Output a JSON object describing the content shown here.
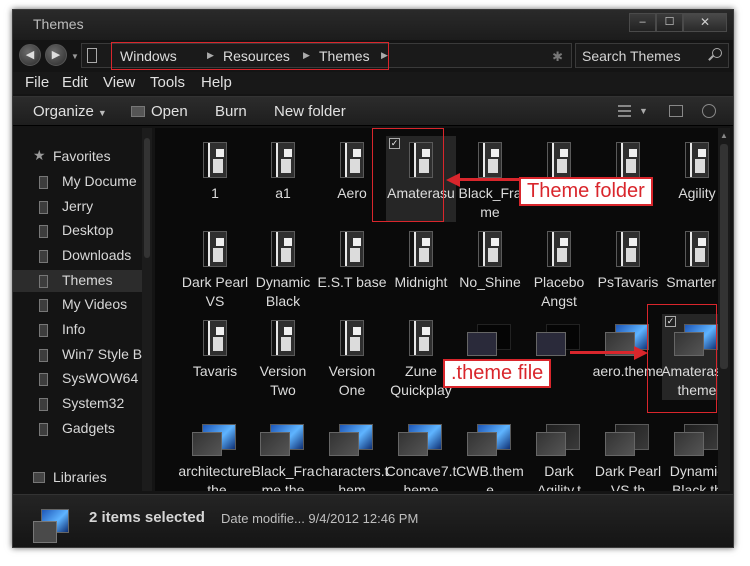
{
  "window": {
    "title": "Themes",
    "min_label": "–",
    "max_label": "☐",
    "close_label": "✕"
  },
  "address": {
    "crumbs": [
      "Windows",
      "Resources",
      "Themes"
    ],
    "search_placeholder": "Search Themes",
    "back_glyph": "◀",
    "forward_glyph": "▶"
  },
  "menu": [
    "File",
    "Edit",
    "View",
    "Tools",
    "Help"
  ],
  "toolbar": {
    "organize": "Organize",
    "open": "Open",
    "burn": "Burn",
    "new_folder": "New folder"
  },
  "sidebar": {
    "favorites": "Favorites",
    "items": [
      "My Docume",
      "Jerry",
      "Desktop",
      "Downloads",
      "Themes",
      "My Videos",
      "Info",
      "Win7 Style B",
      "SysWOW64",
      "System32",
      "Gadgets"
    ],
    "selected": "Themes",
    "libraries": "Libraries"
  },
  "files": [
    {
      "label": "1",
      "kind": "folder"
    },
    {
      "label": "a1",
      "kind": "folder"
    },
    {
      "label": "Aero",
      "kind": "folder"
    },
    {
      "label": "Amaterasu",
      "kind": "folder",
      "selected": true
    },
    {
      "label": "Black_Frame",
      "kind": "folder"
    },
    {
      "label": "",
      "kind": "folder"
    },
    {
      "label": "",
      "kind": "folder"
    },
    {
      "label": "Agility",
      "kind": "folder"
    },
    {
      "label": "Dark Pearl VS",
      "kind": "folder"
    },
    {
      "label": "Dynamic Black",
      "kind": "folder"
    },
    {
      "label": "E.S.T base",
      "kind": "folder"
    },
    {
      "label": "Midnight",
      "kind": "folder"
    },
    {
      "label": "No_Shine",
      "kind": "folder"
    },
    {
      "label": "Placebo Angst",
      "kind": "folder"
    },
    {
      "label": "PsTavaris",
      "kind": "folder"
    },
    {
      "label": "Smarter 7",
      "kind": "folder"
    },
    {
      "label": "Tavaris",
      "kind": "folder"
    },
    {
      "label": "Version Two",
      "kind": "folder"
    },
    {
      "label": "Version One",
      "kind": "folder"
    },
    {
      "label": "Zune Quickplay",
      "kind": "folder"
    },
    {
      "label": "",
      "kind": "theme-flat"
    },
    {
      "label": "",
      "kind": "theme-flat"
    },
    {
      "label": "aero.theme",
      "kind": "theme"
    },
    {
      "label": "Amaterasu.theme",
      "kind": "theme",
      "selected": true
    },
    {
      "label": "architecture.the",
      "kind": "theme"
    },
    {
      "label": "Black_Frame.the",
      "kind": "theme"
    },
    {
      "label": "characters.them",
      "kind": "theme"
    },
    {
      "label": "Concave7.theme",
      "kind": "theme"
    },
    {
      "label": "CWB.theme",
      "kind": "theme"
    },
    {
      "label": "Dark Agility.t",
      "kind": "theme-dark"
    },
    {
      "label": "Dark Pearl VS.th",
      "kind": "theme-dark"
    },
    {
      "label": "Dynamic Black.th",
      "kind": "theme-dark"
    }
  ],
  "annotations": {
    "folder_callout": "Theme folder",
    "file_callout": ".theme file"
  },
  "details": {
    "count": "2 items selected",
    "meta": "Date modifie... 9/4/2012 12:46 PM"
  },
  "colors": {
    "accent_red": "#d9262c",
    "window_bg": "#141414",
    "text": "#dcdcdc"
  }
}
